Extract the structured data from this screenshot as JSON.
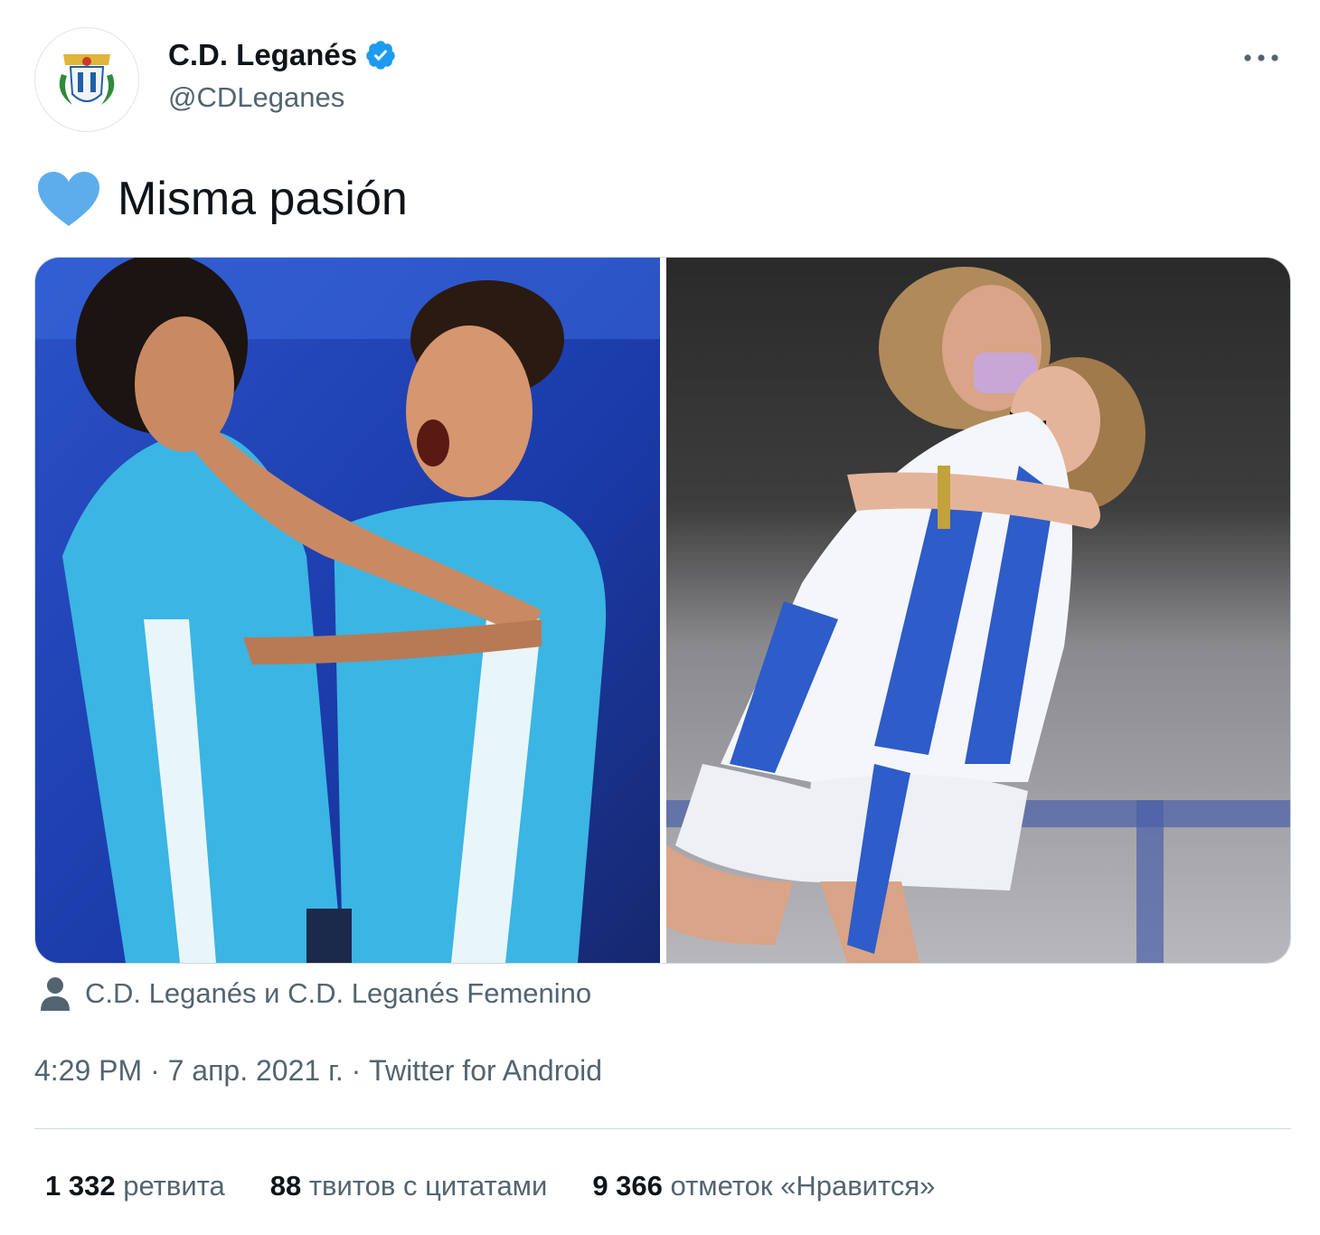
{
  "author": {
    "display_name": "C.D. Leganés",
    "handle": "@CDLeganes",
    "verified": true,
    "avatar_icon": "club-crest-icon"
  },
  "tweet": {
    "emoji_icon": "blue-heart-icon",
    "text": "Misma pasión"
  },
  "media": {
    "photos": [
      {
        "name": "mens-team-celebration-photo",
        "alt_icon": "photo"
      },
      {
        "name": "womens-team-celebration-photo",
        "alt_icon": "photo"
      }
    ]
  },
  "tagged": {
    "icon": "person-icon",
    "text": "C.D. Leganés и C.D. Leganés Femenino"
  },
  "meta": {
    "time": "4:29 PM",
    "sep1": " · ",
    "date": "7 апр. 2021 г.",
    "sep2": " · ",
    "source": "Twitter for Android"
  },
  "stats": {
    "retweets_count": "1 332",
    "retweets_label": "ретвита",
    "quotes_count": "88",
    "quotes_label": "твитов с цитатами",
    "likes_count": "9 366",
    "likes_label": "отметок «Нравится»"
  },
  "colors": {
    "text_primary": "#0f1419",
    "text_secondary": "#536471",
    "verified_blue": "#1d9bf0",
    "heart_blue": "#5dadec",
    "divider": "#cfd9de"
  }
}
